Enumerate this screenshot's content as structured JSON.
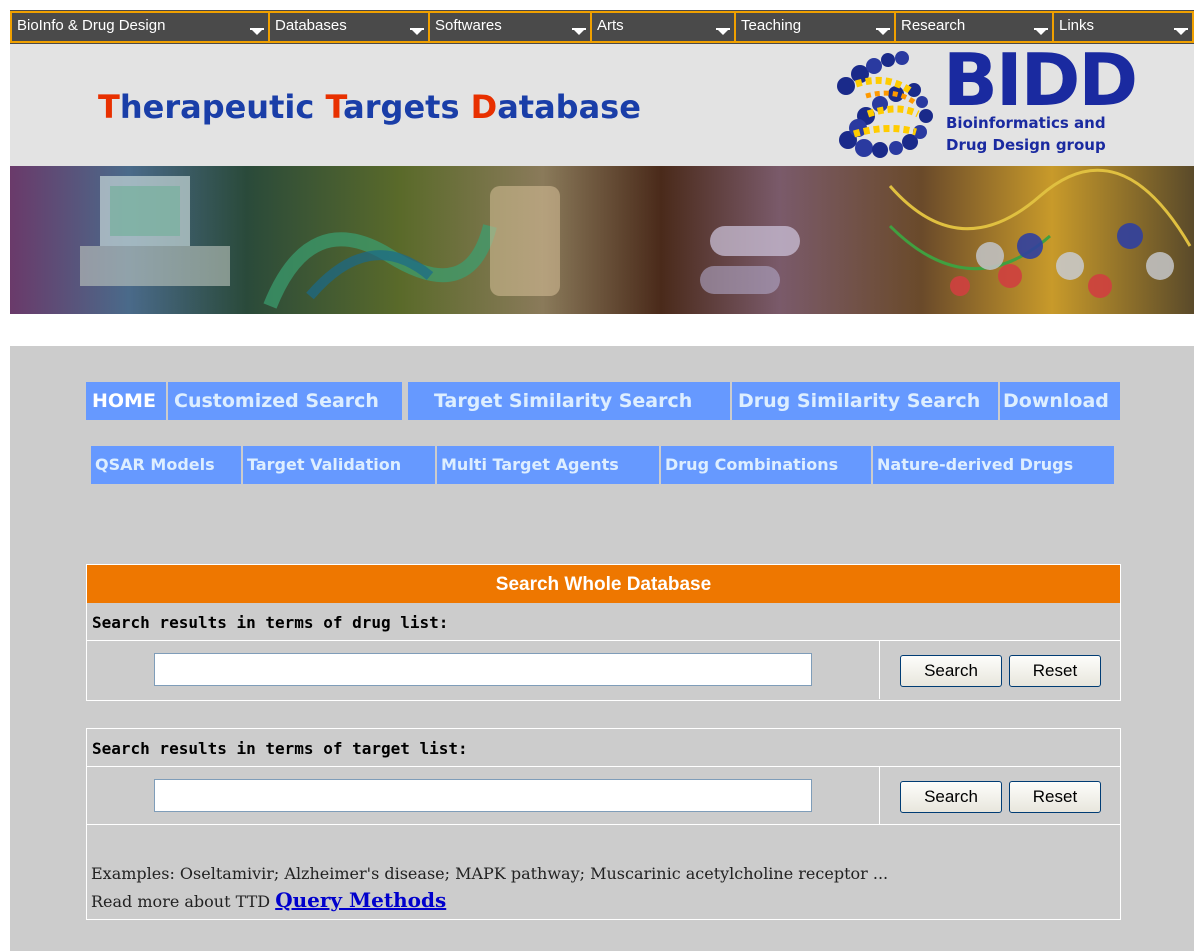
{
  "top_menu": [
    {
      "label": "BioInfo & Drug Design",
      "icon": "dropdown-arrow-icon"
    },
    {
      "label": "Databases",
      "icon": "dropdown-arrow-icon"
    },
    {
      "label": "Softwares",
      "icon": "dropdown-arrow-icon"
    },
    {
      "label": "Arts",
      "icon": "dropdown-arrow-icon"
    },
    {
      "label": "Teaching",
      "icon": "dropdown-arrow-icon"
    },
    {
      "label": "Research",
      "icon": "dropdown-arrow-icon"
    },
    {
      "label": "Links",
      "icon": "dropdown-arrow-icon"
    }
  ],
  "header": {
    "title_parts": [
      {
        "hl": "T",
        "rest": "herapeutic "
      },
      {
        "hl": "T",
        "rest": "argets "
      },
      {
        "hl": "D",
        "rest": "atabase"
      }
    ],
    "logo": {
      "letters": "BIDD",
      "line1": "Bioinformatics and",
      "line2": "Drug Design group"
    }
  },
  "nav_row1": [
    "HOME",
    "Customized Search",
    "Target Similarity Search",
    "Drug Similarity Search",
    "Download"
  ],
  "nav_row2": [
    "QSAR Models",
    "Target Validation",
    "Multi Target Agents",
    "Drug Combinations",
    "Nature-derived Drugs"
  ],
  "search_panel": {
    "title": "Search Whole Database",
    "drug_label": "Search results in terms of drug list:",
    "drug_value": "",
    "target_label": "Search results in terms of target list:",
    "target_value": "",
    "search_button": "Search",
    "reset_button": "Reset",
    "examples": "Examples: Oseltamivir; Alzheimer's disease; MAPK pathway; Muscarinic acetylcholine receptor ...",
    "read_more": "Read more about TTD ",
    "query_link": "Query Methods"
  },
  "colors": {
    "menu_bg": "#4a4a4a",
    "menu_border": "#f0a000",
    "title_blue": "#1a3ea8",
    "title_red": "#e83000",
    "nav_blue": "#6699ff",
    "panel_orange": "#ee7700",
    "content_gray": "#cccccc"
  }
}
